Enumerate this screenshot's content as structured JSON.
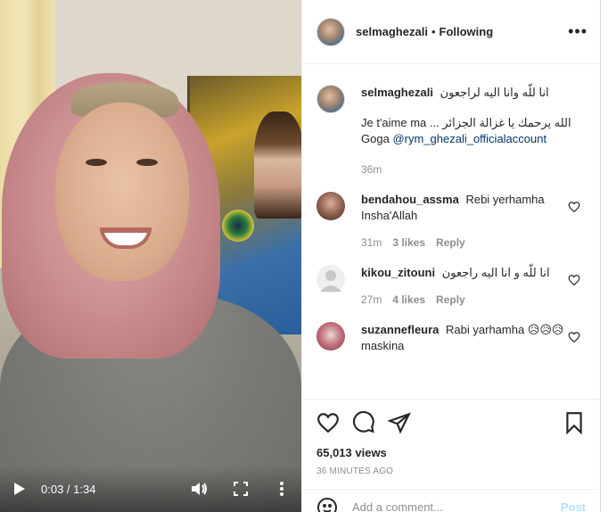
{
  "video": {
    "current_time": "0:03",
    "duration": "1:34",
    "time_display": "0:03 / 1:34",
    "icons": [
      "play-icon",
      "volume-icon",
      "fullscreen-icon",
      "more-vertical-icon"
    ]
  },
  "header": {
    "username": "selmaghezali",
    "separator": "•",
    "follow_status": "Following",
    "more": "•••"
  },
  "caption": {
    "username": "selmaghezali",
    "line1": "انا للّه وانا اليه لراجعون",
    "line2": "الله يرحمك يا غزالة الجزائر ... Je t'aime ma Goga",
    "mention": "@rym_ghezali_officialaccount",
    "time": "36m"
  },
  "comments": [
    {
      "username": "bendahou_assma",
      "text": "Rebi yerhamha Insha'Allah",
      "time": "31m",
      "likes": "3 likes",
      "reply": "Reply"
    },
    {
      "username": "kikou_zitouni",
      "text": "انا للّه و انا اليه راجعون",
      "time": "27m",
      "likes": "4 likes",
      "reply": "Reply"
    },
    {
      "username": "suzannefleura",
      "text": "Rabi yarhamha 😥😥😥 maskina"
    }
  ],
  "actions": {
    "views": "65,013 views",
    "time_ago": "36 MINUTES AGO",
    "icons": [
      "heart-icon",
      "comment-icon",
      "share-icon",
      "bookmark-icon"
    ]
  },
  "add_comment": {
    "placeholder": "Add a comment...",
    "post_label": "Post"
  },
  "colors": {
    "link": "#00376b",
    "muted": "#8e8e8e",
    "post_disabled": "#b2dffc"
  }
}
